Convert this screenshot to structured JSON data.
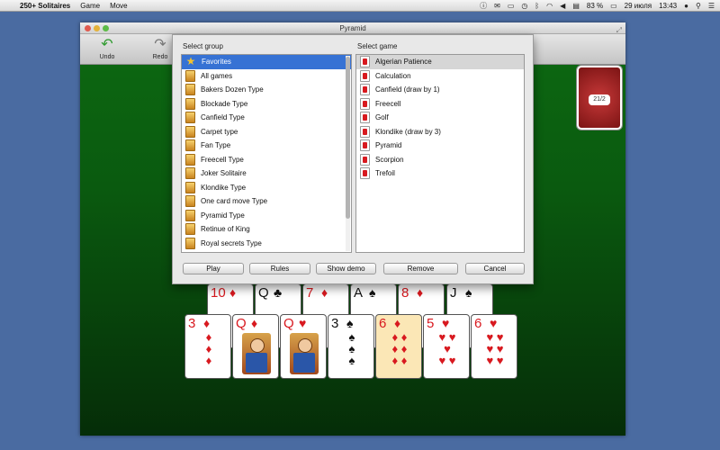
{
  "menubar": {
    "app_name": "250+ Solitaires",
    "menus": [
      "Game",
      "Move"
    ],
    "battery": "83 %",
    "date": "29 июля",
    "time": "13:43"
  },
  "window": {
    "title": "Pyramid",
    "toolbar": {
      "undo_label": "Undo",
      "redo_label": "Redo"
    },
    "deck_count": "21/2"
  },
  "dialog": {
    "group_label": "Select group",
    "game_label": "Select game",
    "groups": [
      "Favorites",
      "All games",
      "Bakers Dozen Type",
      "Blockade Type",
      "Canfield Type",
      "Carpet type",
      "Fan Type",
      "Freecell Type",
      "Joker Solitaire",
      "Klondike Type",
      "One card move Type",
      "Pyramid Type",
      "Retinue of King",
      "Royal secrets Type"
    ],
    "games": [
      "Algerian Patience",
      "Calculation",
      "Canfield (draw by 1)",
      "Freecell",
      "Golf",
      "Klondike (draw by 3)",
      "Pyramid",
      "Scorpion",
      "Trefoil"
    ],
    "buttons": {
      "play": "Play",
      "rules": "Rules",
      "show_demo": "Show demo",
      "remove": "Remove",
      "cancel": "Cancel"
    }
  },
  "cards": {
    "top_row": [
      {
        "rank": "10",
        "suit": "♦"
      },
      {
        "rank": "Q",
        "suit": "♣"
      },
      {
        "rank": "7",
        "suit": "♦"
      },
      {
        "rank": "A",
        "suit": "♠"
      },
      {
        "rank": "8",
        "suit": "♦"
      },
      {
        "rank": "J",
        "suit": "♠"
      }
    ],
    "bottom_row": [
      {
        "rank": "3",
        "suit": "♦"
      },
      {
        "rank": "Q",
        "suit": "♦"
      },
      {
        "rank": "Q",
        "suit": "♥"
      },
      {
        "rank": "3",
        "suit": "♠"
      },
      {
        "rank": "6",
        "suit": "♦"
      },
      {
        "rank": "5",
        "suit": "♥"
      },
      {
        "rank": "6",
        "suit": "♥"
      }
    ]
  }
}
